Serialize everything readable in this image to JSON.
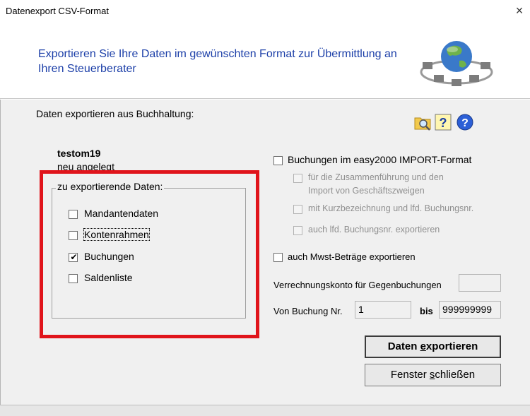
{
  "window": {
    "title": "Datenexport CSV-Format",
    "close_glyph": "×"
  },
  "header": {
    "heading": "Exportieren Sie Ihre Daten im gewünschten Format zur Übermittlung an Ihren Steuerberater",
    "image_icon": "globe-network-icon"
  },
  "main": {
    "source_label": "Daten exportieren aus Buchhaltung:",
    "toolbar_icons": [
      "folder-search-icon",
      "help-question-icon",
      "info-help-icon"
    ],
    "company": {
      "name": "testom19",
      "status": "neu angelegt"
    },
    "data_group": {
      "legend": "zu exportierende Daten:",
      "items": [
        {
          "label": "Mandantendaten",
          "checked": false
        },
        {
          "label": "Kontenrahmen",
          "checked": false
        },
        {
          "label": "Buchungen",
          "checked": true
        },
        {
          "label": "Saldenliste",
          "checked": false
        }
      ]
    },
    "options": {
      "import_format": {
        "label": "Buchungen im easy2000 IMPORT-Format",
        "checked": false
      },
      "merge_branches": {
        "label_line1": "für die Zusammenführung und den",
        "label_line2": "Import von Geschäftszweigen",
        "checked": false,
        "enabled": false
      },
      "short_names": {
        "label": "mit Kurzbezeichnung und lfd. Buchungsnr.",
        "checked": false,
        "enabled": false
      },
      "export_booking_no": {
        "label": "auch lfd. Buchungsnr. exportieren",
        "checked": false,
        "enabled": false
      },
      "vat_amounts": {
        "label": "auch Mwst-Beträge exportieren",
        "checked": false
      }
    },
    "clearing_account": {
      "label": "Verrechnungskonto für Gegenbuchungen",
      "value": ""
    },
    "range": {
      "from_label": "Von Buchung Nr.",
      "from_value": "1",
      "to_label": "bis",
      "to_value": "999999999"
    },
    "buttons": {
      "export": {
        "pre": "Daten ",
        "accel": "e",
        "post": "xportieren"
      },
      "close": {
        "pre": "Fenster ",
        "accel": "s",
        "post": "chließen"
      }
    }
  },
  "colors": {
    "heading": "#1c3fa8",
    "highlight": "#e0141b",
    "panel": "#f0f0f0"
  }
}
